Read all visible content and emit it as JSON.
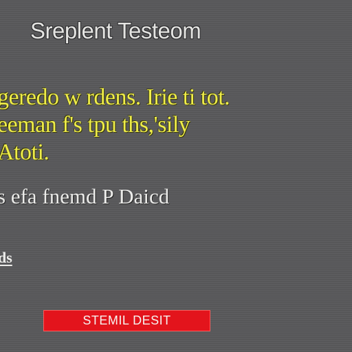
{
  "window": {
    "title": "Sreplent Testeom"
  },
  "notice": {
    "lines": [
      "geredo w rdens.  Irie  ti tot.",
      "eeman  f's  tpu  ths,'sily",
      "Atoti."
    ]
  },
  "subline": "s efa  fnemd P Daicd",
  "small_mark": "ds",
  "button": {
    "label": "STEMIL DESIT"
  },
  "colors": {
    "background": "#58585a",
    "notice_text": "#efed4a",
    "title_text": "#e4e4e2",
    "button_bg": "#e3141c",
    "button_text": "#f6f3f0"
  }
}
